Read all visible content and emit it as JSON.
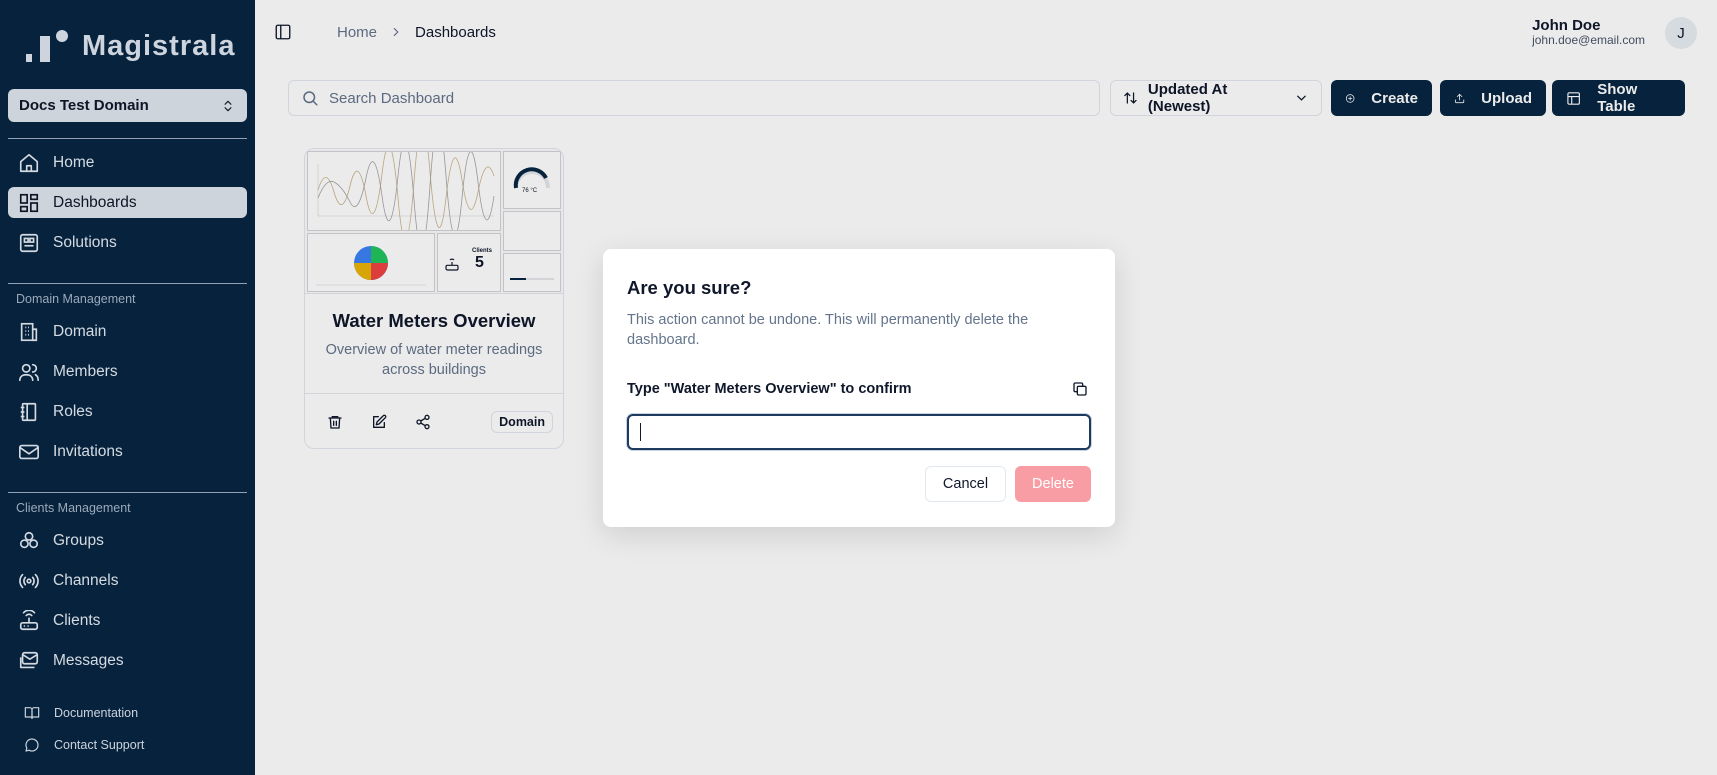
{
  "app": {
    "name": "Magistrala"
  },
  "sidebar": {
    "domain_selector": "Docs Test Domain",
    "main_items": [
      {
        "label": "Home",
        "icon": "home-icon"
      },
      {
        "label": "Dashboards",
        "icon": "dashboard-icon",
        "active": true
      },
      {
        "label": "Solutions",
        "icon": "solutions-icon"
      }
    ],
    "domain_section_label": "Domain Management",
    "domain_items": [
      {
        "label": "Domain",
        "icon": "building-icon"
      },
      {
        "label": "Members",
        "icon": "users-icon"
      },
      {
        "label": "Roles",
        "icon": "notebook-icon"
      },
      {
        "label": "Invitations",
        "icon": "mail-icon"
      }
    ],
    "clients_section_label": "Clients Management",
    "clients_items": [
      {
        "label": "Groups",
        "icon": "groups-icon"
      },
      {
        "label": "Channels",
        "icon": "radio-icon"
      },
      {
        "label": "Clients",
        "icon": "router-icon"
      },
      {
        "label": "Messages",
        "icon": "messages-icon"
      }
    ],
    "footer_items": [
      {
        "label": "Documentation",
        "icon": "book-icon"
      },
      {
        "label": "Contact Support",
        "icon": "chat-icon"
      }
    ]
  },
  "header": {
    "breadcrumb": [
      "Home",
      "Dashboards"
    ],
    "user": {
      "name": "John Doe",
      "email": "john.doe@email.com",
      "avatar_initial": "J"
    }
  },
  "toolbar": {
    "search_placeholder": "Search Dashboard",
    "sort_label": "Updated At (Newest)",
    "create_label": "Create",
    "upload_label": "Upload",
    "show_table_label": "Show Table"
  },
  "dashboards": [
    {
      "title": "Water Meters Overview",
      "description": "Overview of water meter readings across buildings",
      "badge": "Domain",
      "thumbnail": {
        "gauge_value": "76 °C",
        "clients_label": "Clients",
        "clients_value": "5"
      }
    }
  ],
  "dialog": {
    "title": "Are you sure?",
    "description": "This action cannot be undone. This will permanently delete the dashboard.",
    "confirm_label": "Type \"Water Meters Overview\" to confirm",
    "input_value": "",
    "cancel_label": "Cancel",
    "delete_label": "Delete"
  },
  "colors": {
    "sidebar_bg": "#072542",
    "primary": "#072542",
    "delete_disabled": "#f89da4",
    "active_item_bg": "#dfe6ee"
  }
}
